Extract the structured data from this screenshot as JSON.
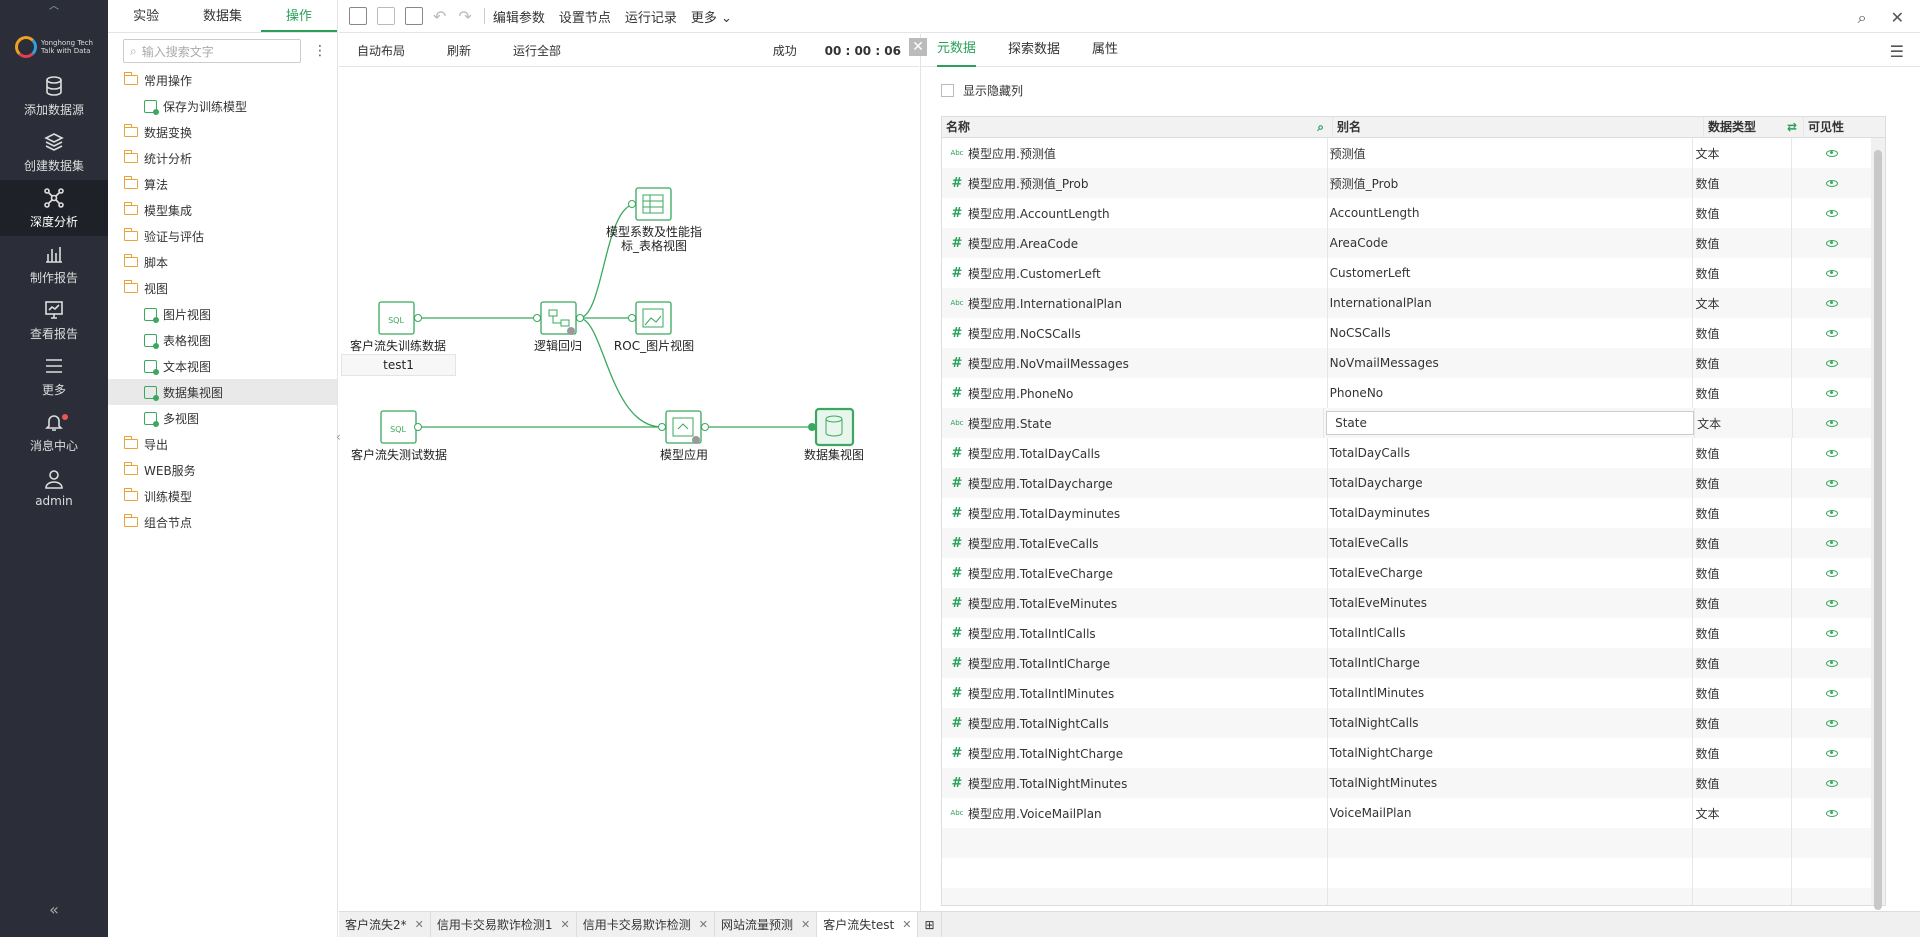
{
  "nav": {
    "logo_line1": "Yonghong Tech",
    "logo_line2": "Talk with Data",
    "items": [
      {
        "label": "添加数据源"
      },
      {
        "label": "创建数据集"
      },
      {
        "label": "深度分析"
      },
      {
        "label": "制作报告"
      },
      {
        "label": "查看报告"
      },
      {
        "label": "更多"
      },
      {
        "label": "消息中心"
      },
      {
        "label": "admin"
      }
    ],
    "collapse": "«"
  },
  "tree": {
    "tabs": [
      "实验",
      "数据集",
      "操作"
    ],
    "search_placeholder": "输入搜索文字",
    "items": [
      {
        "label": "常用操作",
        "kind": "folder"
      },
      {
        "label": "保存为训练模型",
        "kind": "leaf"
      },
      {
        "label": "数据变换",
        "kind": "folder"
      },
      {
        "label": "统计分析",
        "kind": "folder"
      },
      {
        "label": "算法",
        "kind": "folder"
      },
      {
        "label": "模型集成",
        "kind": "folder"
      },
      {
        "label": "验证与评估",
        "kind": "folder"
      },
      {
        "label": "脚本",
        "kind": "folder"
      },
      {
        "label": "视图",
        "kind": "folder"
      },
      {
        "label": "图片视图",
        "kind": "leaf"
      },
      {
        "label": "表格视图",
        "kind": "leaf"
      },
      {
        "label": "文本视图",
        "kind": "leaf"
      },
      {
        "label": "数据集视图",
        "kind": "leaf"
      },
      {
        "label": "多视图",
        "kind": "leaf"
      },
      {
        "label": "导出",
        "kind": "folder"
      },
      {
        "label": "WEB服务",
        "kind": "folder"
      },
      {
        "label": "训练模型",
        "kind": "folder"
      },
      {
        "label": "组合节点",
        "kind": "folder"
      }
    ]
  },
  "toolbar": {
    "edit_params": "编辑参数",
    "set_node": "设置节点",
    "run_log": "运行记录",
    "more": "更多"
  },
  "canvas": {
    "auto_layout": "自动布局",
    "refresh": "刷新",
    "run_all": "运行全部",
    "status_label": "成功",
    "status_time": "00 : 00 : 06",
    "nodes": {
      "train_data": "客户流失训练数据",
      "train_sub": "test1",
      "test_data": "客户流失测试数据",
      "logistic": "逻辑回归",
      "coef_line1": "模型系数及性能指",
      "coef_line2": "标_表格视图",
      "roc": "ROC_图片视图",
      "apply": "模型应用",
      "dataset_view": "数据集视图"
    }
  },
  "meta": {
    "tabs": [
      "元数据",
      "探索数据",
      "属性"
    ],
    "show_hidden": "显示隐藏列",
    "headers": {
      "name": "名称",
      "alias": "别名",
      "type": "数据类型",
      "visible": "可见性"
    },
    "rows": [
      {
        "kind": "abc",
        "name": "模型应用.预测值",
        "alias": "预测值",
        "type": "文本"
      },
      {
        "kind": "num",
        "name": "模型应用.预测值_Prob",
        "alias": "预测值_Prob",
        "type": "数值"
      },
      {
        "kind": "num",
        "name": "模型应用.AccountLength",
        "alias": "AccountLength",
        "type": "数值"
      },
      {
        "kind": "num",
        "name": "模型应用.AreaCode",
        "alias": "AreaCode",
        "type": "数值"
      },
      {
        "kind": "num",
        "name": "模型应用.CustomerLeft",
        "alias": "CustomerLeft",
        "type": "数值"
      },
      {
        "kind": "abc",
        "name": "模型应用.InternationalPlan",
        "alias": "InternationalPlan",
        "type": "文本"
      },
      {
        "kind": "num",
        "name": "模型应用.NoCSCalls",
        "alias": "NoCSCalls",
        "type": "数值"
      },
      {
        "kind": "num",
        "name": "模型应用.NoVmailMessages",
        "alias": "NoVmailMessages",
        "type": "数值"
      },
      {
        "kind": "num",
        "name": "模型应用.PhoneNo",
        "alias": "PhoneNo",
        "type": "数值"
      },
      {
        "kind": "abc",
        "name": "模型应用.State",
        "alias": "State",
        "type": "文本",
        "editing": true
      },
      {
        "kind": "num",
        "name": "模型应用.TotalDayCalls",
        "alias": "TotalDayCalls",
        "type": "数值"
      },
      {
        "kind": "num",
        "name": "模型应用.TotalDaycharge",
        "alias": "TotalDaycharge",
        "type": "数值"
      },
      {
        "kind": "num",
        "name": "模型应用.TotalDayminutes",
        "alias": "TotalDayminutes",
        "type": "数值"
      },
      {
        "kind": "num",
        "name": "模型应用.TotalEveCalls",
        "alias": "TotalEveCalls",
        "type": "数值"
      },
      {
        "kind": "num",
        "name": "模型应用.TotalEveCharge",
        "alias": "TotalEveCharge",
        "type": "数值"
      },
      {
        "kind": "num",
        "name": "模型应用.TotalEveMinutes",
        "alias": "TotalEveMinutes",
        "type": "数值"
      },
      {
        "kind": "num",
        "name": "模型应用.TotalIntlCalls",
        "alias": "TotalIntlCalls",
        "type": "数值"
      },
      {
        "kind": "num",
        "name": "模型应用.TotalIntlCharge",
        "alias": "TotalIntlCharge",
        "type": "数值"
      },
      {
        "kind": "num",
        "name": "模型应用.TotalIntlMinutes",
        "alias": "TotalIntlMinutes",
        "type": "数值"
      },
      {
        "kind": "num",
        "name": "模型应用.TotalNightCalls",
        "alias": "TotalNightCalls",
        "type": "数值"
      },
      {
        "kind": "num",
        "name": "模型应用.TotalNightCharge",
        "alias": "TotalNightCharge",
        "type": "数值"
      },
      {
        "kind": "num",
        "name": "模型应用.TotalNightMinutes",
        "alias": "TotalNightMinutes",
        "type": "数值"
      },
      {
        "kind": "abc",
        "name": "模型应用.VoiceMailPlan",
        "alias": "VoiceMailPlan",
        "type": "文本"
      }
    ]
  },
  "bottom_tabs": [
    {
      "label": "客户流失2*"
    },
    {
      "label": "信用卡交易欺诈检测1"
    },
    {
      "label": "信用卡交易欺诈检测"
    },
    {
      "label": "网站流量预测"
    },
    {
      "label": "客户流失test",
      "active": true
    }
  ],
  "colors": {
    "accent": "#2aa05a",
    "nav_bg": "#2b2e38",
    "folder": "#e8a33d"
  }
}
